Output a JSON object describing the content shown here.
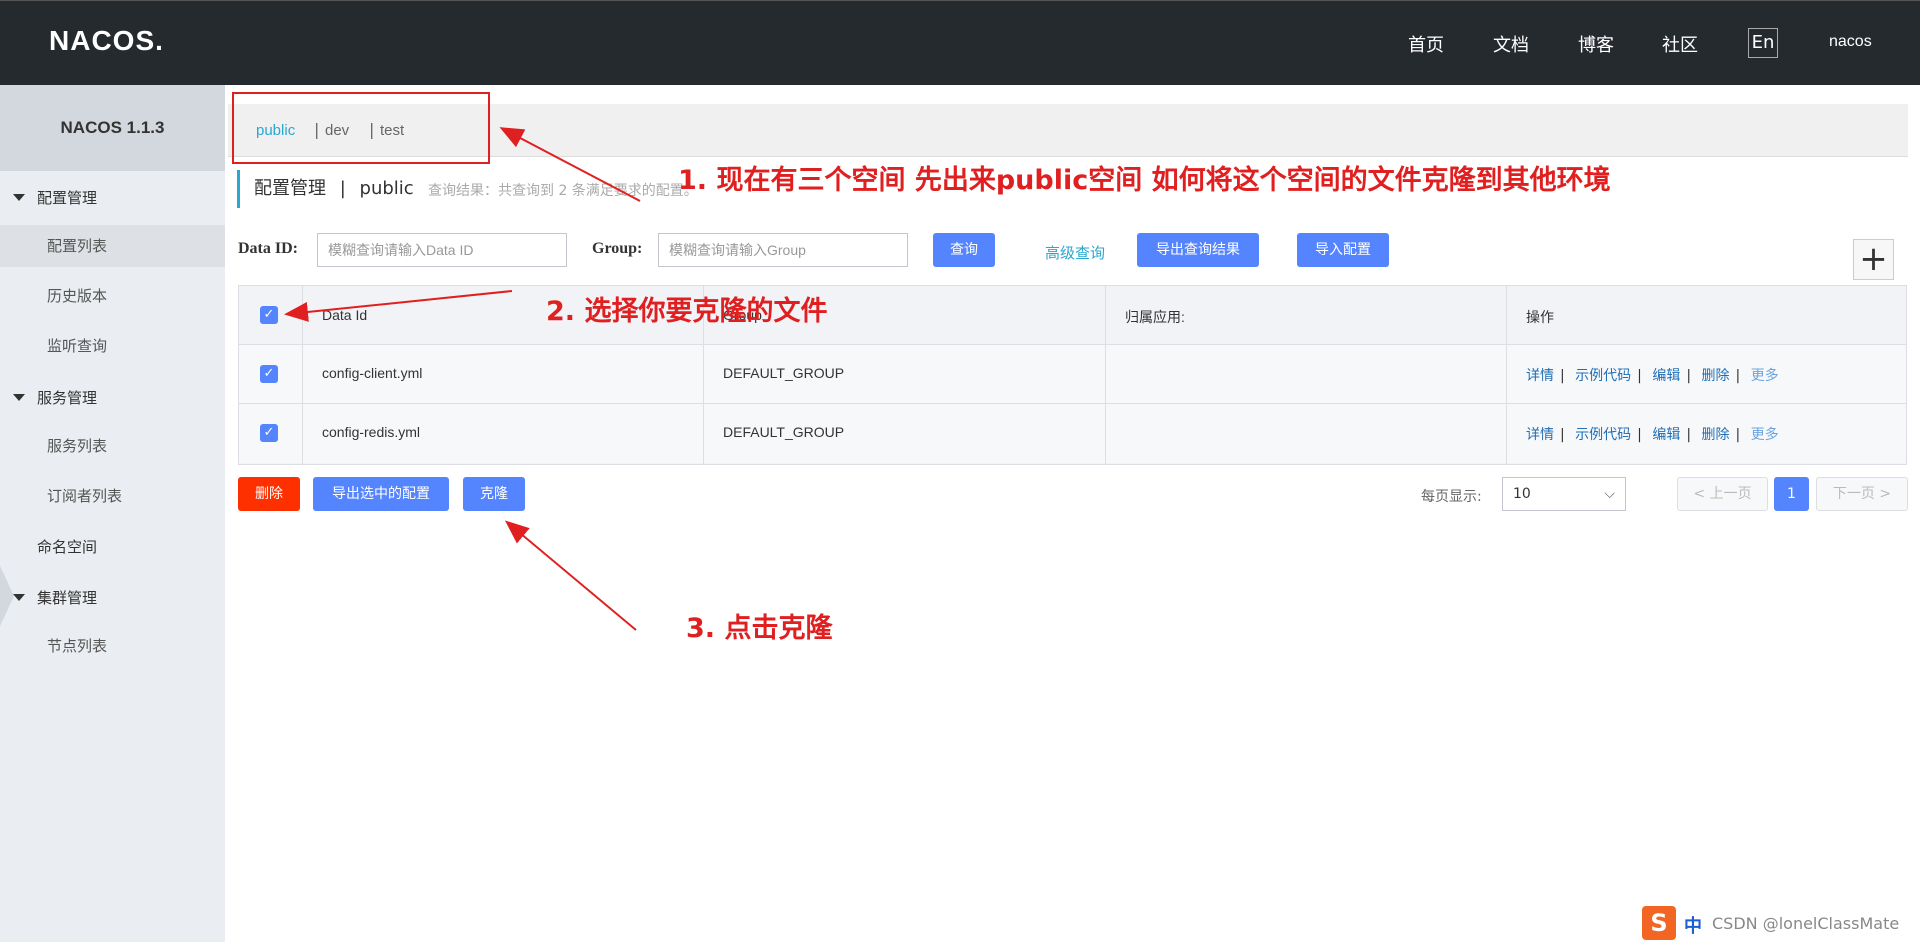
{
  "header": {
    "logo": "NACOS.",
    "nav": [
      "首页",
      "文档",
      "博客",
      "社区"
    ],
    "lang": "En",
    "user": "nacos"
  },
  "sidebar": {
    "version": "NACOS 1.1.3",
    "groups": [
      {
        "label": "配置管理",
        "items": [
          "配置列表",
          "历史版本",
          "监听查询"
        ]
      },
      {
        "label": "服务管理",
        "items": [
          "服务列表",
          "订阅者列表"
        ]
      },
      {
        "label": "命名空间"
      },
      {
        "label": "集群管理",
        "items": [
          "节点列表"
        ]
      }
    ]
  },
  "namespaces": [
    "public",
    "dev",
    "test"
  ],
  "page": {
    "title": "配置管理",
    "sep": "|",
    "namespace": "public",
    "query_result": "查询结果：共查询到 2 条满足要求的配置。"
  },
  "search": {
    "dataid_label": "Data ID:",
    "dataid_placeholder": "模糊查询请输入Data ID",
    "group_label": "Group:",
    "group_placeholder": "模糊查询请输入Group",
    "query_btn": "查询",
    "advanced": "高级查询",
    "export_btn": "导出查询结果",
    "import_btn": "导入配置",
    "add": "+"
  },
  "table": {
    "columns": [
      "Data Id",
      "Group",
      "归属应用:",
      "操作"
    ],
    "rows": [
      {
        "data_id": "config-client.yml",
        "group": "DEFAULT_GROUP",
        "app": ""
      },
      {
        "data_id": "config-redis.yml",
        "group": "DEFAULT_GROUP",
        "app": ""
      }
    ],
    "ops": [
      "详情",
      "示例代码",
      "编辑",
      "删除",
      "更多"
    ],
    "check": "✓"
  },
  "actions": {
    "delete": "删除",
    "export_selected": "导出选中的配置",
    "clone": "克隆"
  },
  "pagination": {
    "per_page_label": "每页显示:",
    "per_page": "10",
    "prev": "上一页",
    "page": "1",
    "next": "下一页"
  },
  "annotations": {
    "step1": "1. 现在有三个空间 先出来public空间 如何将这个空间的文件克隆到其他环境",
    "step2": "2. 选择你要克隆的文件",
    "step3": "3. 点击克隆",
    "color": "#e02020"
  },
  "ime": {
    "logo": "S",
    "mode": "中",
    "watermark": "CSDN @lonelClassMate"
  },
  "colors": {
    "topbar": "#252a2f",
    "primary": "#5584ff",
    "danger": "#ff3000",
    "link": "#2aa7d0"
  }
}
